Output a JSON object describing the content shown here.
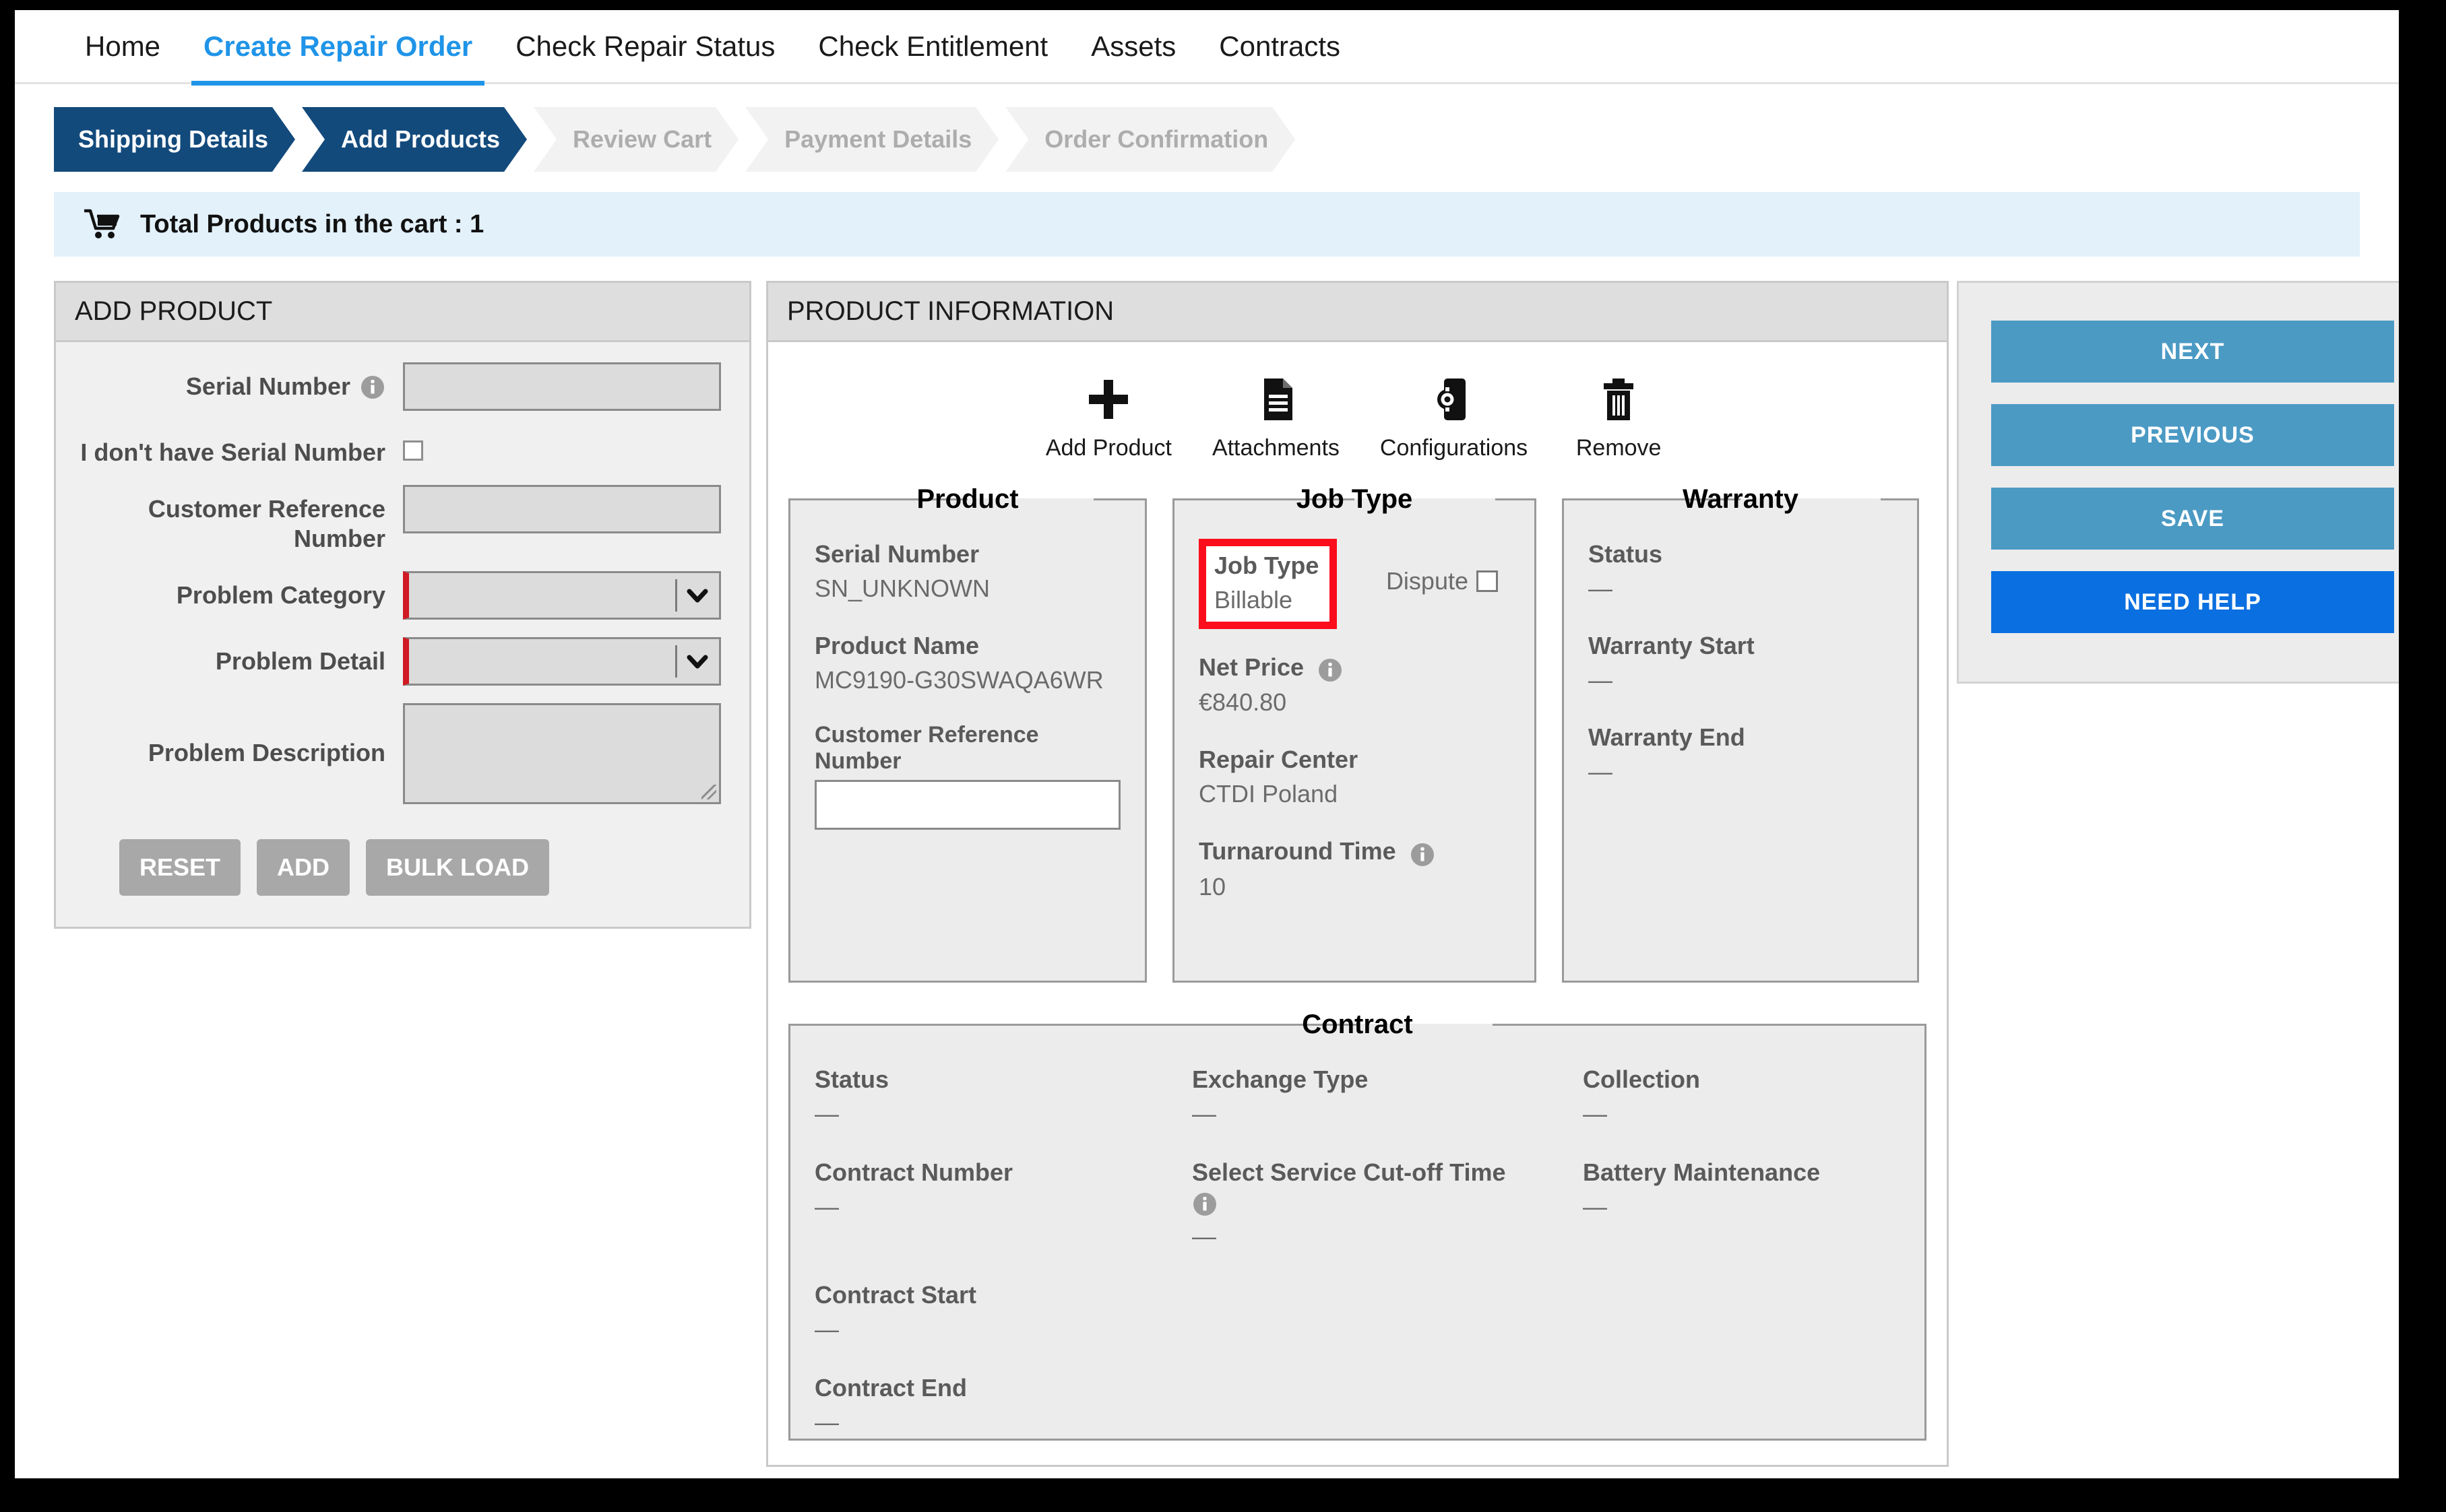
{
  "nav": {
    "items": [
      {
        "label": "Home",
        "active": false
      },
      {
        "label": "Create Repair Order",
        "active": true
      },
      {
        "label": "Check Repair Status",
        "active": false
      },
      {
        "label": "Check Entitlement",
        "active": false
      },
      {
        "label": "Assets",
        "active": false
      },
      {
        "label": "Contracts",
        "active": false
      }
    ]
  },
  "wizard": {
    "steps": [
      {
        "label": "Shipping Details",
        "state": "done"
      },
      {
        "label": "Add Products",
        "state": "current"
      },
      {
        "label": "Review Cart",
        "state": "todo"
      },
      {
        "label": "Payment Details",
        "state": "todo"
      },
      {
        "label": "Order Confirmation",
        "state": "todo"
      }
    ]
  },
  "cart": {
    "icon": "shopping-cart-icon",
    "text": "Total Products in the cart : 1",
    "count": "1"
  },
  "add_product": {
    "title": "ADD PRODUCT",
    "fields": {
      "serial_number_label": "Serial Number",
      "serial_number_value": "",
      "no_serial_label": "I don't have Serial Number",
      "customer_ref_label": "Customer Reference Number",
      "customer_ref_value": "",
      "problem_category_label": "Problem Category",
      "problem_category_value": "",
      "problem_detail_label": "Problem Detail",
      "problem_detail_value": "",
      "problem_description_label": "Problem Description",
      "problem_description_value": ""
    },
    "buttons": {
      "reset": "RESET",
      "add": "ADD",
      "bulk_load": "BULK LOAD"
    }
  },
  "product_information": {
    "title": "PRODUCT INFORMATION",
    "toolbar": [
      {
        "label": "Add Product",
        "icon": "plus-icon"
      },
      {
        "label": "Attachments",
        "icon": "document-icon"
      },
      {
        "label": "Configurations",
        "icon": "configurations-icon"
      },
      {
        "label": "Remove",
        "icon": "trash-icon"
      }
    ],
    "product": {
      "legend": "Product",
      "serial_number_label": "Serial Number",
      "serial_number_value": "SN_UNKNOWN",
      "product_name_label": "Product Name",
      "product_name_value": "MC9190-G30SWAQA6WR",
      "customer_ref_label": "Customer Reference Number",
      "customer_ref_value": ""
    },
    "job_type": {
      "legend": "Job Type",
      "job_type_label": "Job Type",
      "job_type_value": "Billable",
      "dispute_label": "Dispute",
      "net_price_label": "Net Price",
      "net_price_value": "€840.80",
      "repair_center_label": "Repair Center",
      "repair_center_value": "CTDI Poland",
      "turnaround_label": "Turnaround Time",
      "turnaround_value": "10",
      "highlight_color": "#fc0d1b"
    },
    "warranty": {
      "legend": "Warranty",
      "status_label": "Status",
      "status_value": "—",
      "start_label": "Warranty Start",
      "start_value": "—",
      "end_label": "Warranty End",
      "end_value": "—"
    },
    "contract": {
      "legend": "Contract",
      "status_label": "Status",
      "status_value": "—",
      "contract_number_label": "Contract Number",
      "contract_number_value": "—",
      "contract_start_label": "Contract Start",
      "contract_start_value": "—",
      "contract_end_label": "Contract End",
      "contract_end_value": "—",
      "exchange_type_label": "Exchange Type",
      "exchange_type_value": "—",
      "cutoff_label": "Select Service Cut-off Time",
      "cutoff_value": "—",
      "collection_label": "Collection",
      "collection_value": "—",
      "battery_label": "Battery Maintenance",
      "battery_value": "—"
    }
  },
  "actions": {
    "next": "NEXT",
    "previous": "PREVIOUS",
    "save": "SAVE",
    "need_help": "NEED HELP",
    "primary_color": "#4b9ac4",
    "help_color": "#0a6fe0"
  }
}
